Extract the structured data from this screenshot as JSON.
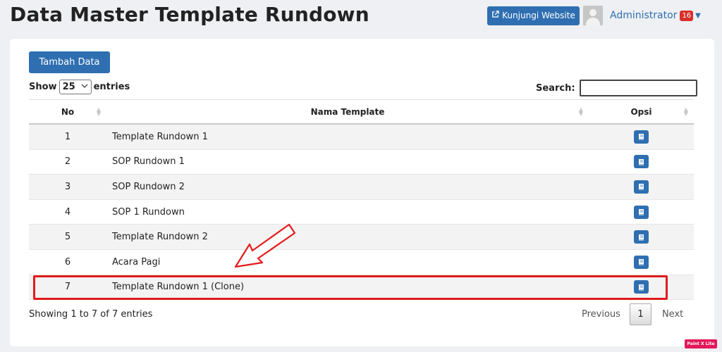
{
  "page": {
    "title": "Data Master Template Rundown"
  },
  "topbar": {
    "visit_label": "Kunjungi Website",
    "visit_icon": "external-link-icon",
    "user_name": "Administrator",
    "notif_count": "16"
  },
  "actions": {
    "add_label": "Tambah Data"
  },
  "length_control": {
    "show_label": "Show",
    "value": "25",
    "entries_label": "entries"
  },
  "search": {
    "label": "Search:",
    "value": ""
  },
  "table": {
    "headers": {
      "no": "No",
      "nama": "Nama Template",
      "opsi": "Opsi"
    },
    "rows": [
      {
        "no": "1",
        "nama": "Template Rundown 1"
      },
      {
        "no": "2",
        "nama": "SOP Rundown 1"
      },
      {
        "no": "3",
        "nama": "SOP Rundown 2"
      },
      {
        "no": "4",
        "nama": "SOP 1 Rundown"
      },
      {
        "no": "5",
        "nama": "Template Rundown 2"
      },
      {
        "no": "6",
        "nama": "Acara Pagi"
      },
      {
        "no": "7",
        "nama": "Template Rundown 1 (Clone)"
      }
    ],
    "opsi_icon": "book-icon"
  },
  "info": {
    "text": "Showing 1 to 7 of 7 entries"
  },
  "pagination": {
    "prev": "Previous",
    "current": "1",
    "next": "Next"
  },
  "watermark": {
    "text": "Paint X Lite"
  },
  "colors": {
    "primary": "#2f6fb1",
    "highlight": "#e21b1b",
    "badge": "#d9302b"
  }
}
